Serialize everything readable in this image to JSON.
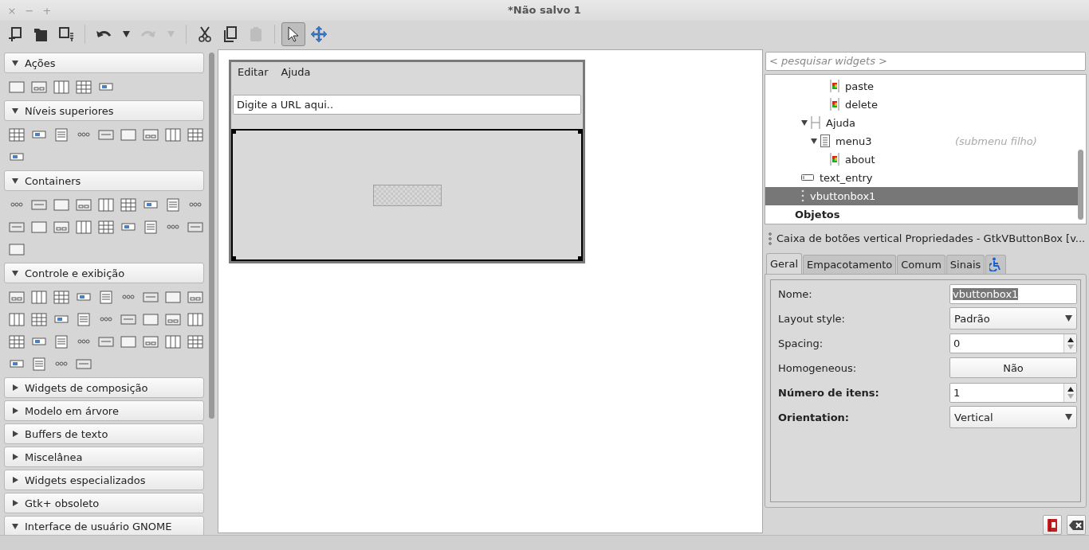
{
  "window": {
    "title": "*Não salvo 1",
    "controls": [
      "×",
      "−",
      "+"
    ]
  },
  "toolbar": [
    {
      "kind": "new",
      "disabled": false
    },
    {
      "kind": "open",
      "disabled": false
    },
    {
      "kind": "save",
      "disabled": false
    },
    {
      "kind": "separator"
    },
    {
      "kind": "undo",
      "disabled": false
    },
    {
      "kind": "dropdown",
      "disabled": false
    },
    {
      "kind": "redo",
      "disabled": true
    },
    {
      "kind": "dropdown",
      "disabled": true
    },
    {
      "kind": "separator"
    },
    {
      "kind": "cut",
      "disabled": false
    },
    {
      "kind": "copy",
      "disabled": false
    },
    {
      "kind": "paste",
      "disabled": true
    },
    {
      "kind": "separator"
    },
    {
      "kind": "select",
      "selected": true
    },
    {
      "kind": "drag",
      "selected": false
    }
  ],
  "palette": [
    {
      "label": "Ações",
      "expanded": true
    },
    {
      "label": "Níveis superiores",
      "expanded": true
    },
    {
      "label": "Containers",
      "expanded": true
    },
    {
      "label": "Controle e exibição",
      "expanded": true
    },
    {
      "label": "Widgets de composição",
      "expanded": false
    },
    {
      "label": "Modelo em árvore",
      "expanded": false
    },
    {
      "label": "Buffers de texto",
      "expanded": false
    },
    {
      "label": "Miscelânea",
      "expanded": false
    },
    {
      "label": "Widgets especializados",
      "expanded": false
    },
    {
      "label": "Gtk+ obsoleto",
      "expanded": false
    },
    {
      "label": "Interface de usuário GNOME",
      "expanded": true
    }
  ],
  "design": {
    "menu": [
      "Editar",
      "Ajuda"
    ],
    "entry": {
      "value": "Digite a URL aqui.."
    },
    "button_box": {
      "selected": true
    }
  },
  "search": {
    "placeholder": "< pesquisar widgets >"
  },
  "tree": [
    {
      "children": [
        {
          "children": [
            {
              "children": [
                {
                  "label": "paste",
                  "kind": "item"
                },
                {
                  "label": "delete",
                  "kind": "item"
                }
              ]
            }
          ]
        },
        {
          "label": "Ajuda",
          "kind": "header",
          "expanded": true,
          "children": [
            {
              "label": "menu3",
              "kind": "menu",
              "note": "(submenu filho)",
              "expanded": true,
              "children": [
                {
                  "label": "about",
                  "kind": "item"
                }
              ]
            }
          ]
        }
      ]
    },
    {
      "label": "text_entry",
      "kind": "entry",
      "selected": false
    },
    {
      "label": "vbuttonbox1",
      "kind": "box",
      "selected": true
    }
  ],
  "tree_section": "Objetos",
  "properties": {
    "title": "Caixa de botões vertical Propriedades - GtkVButtonBox [v...",
    "tabs": [
      {
        "label": "Geral",
        "kind": "text",
        "selected": true
      },
      {
        "label": "Empacotamento",
        "kind": "text",
        "selected": false
      },
      {
        "label": "Comum",
        "kind": "text",
        "selected": false
      },
      {
        "label": "Sinais",
        "kind": "text",
        "selected": false
      },
      {
        "kind": "accessibility",
        "selected": false
      }
    ],
    "rows": [
      {
        "label": "Nome:",
        "bold": false,
        "kind": "entry",
        "value": "vbuttonbox1",
        "value_selected": true
      },
      {
        "label": "Layout style:",
        "bold": false,
        "kind": "combo",
        "value": "Padrão"
      },
      {
        "label": "Spacing:",
        "bold": false,
        "kind": "spin",
        "value": "0",
        "down_disabled": true
      },
      {
        "label": "Homogeneous:",
        "bold": false,
        "kind": "toggle",
        "value": "Não"
      },
      {
        "label": "Número de itens:",
        "bold": true,
        "kind": "spin",
        "value": "1",
        "down_disabled": true
      },
      {
        "label": "Orientation:",
        "bold": true,
        "kind": "combo",
        "value": "Vertical"
      }
    ]
  }
}
